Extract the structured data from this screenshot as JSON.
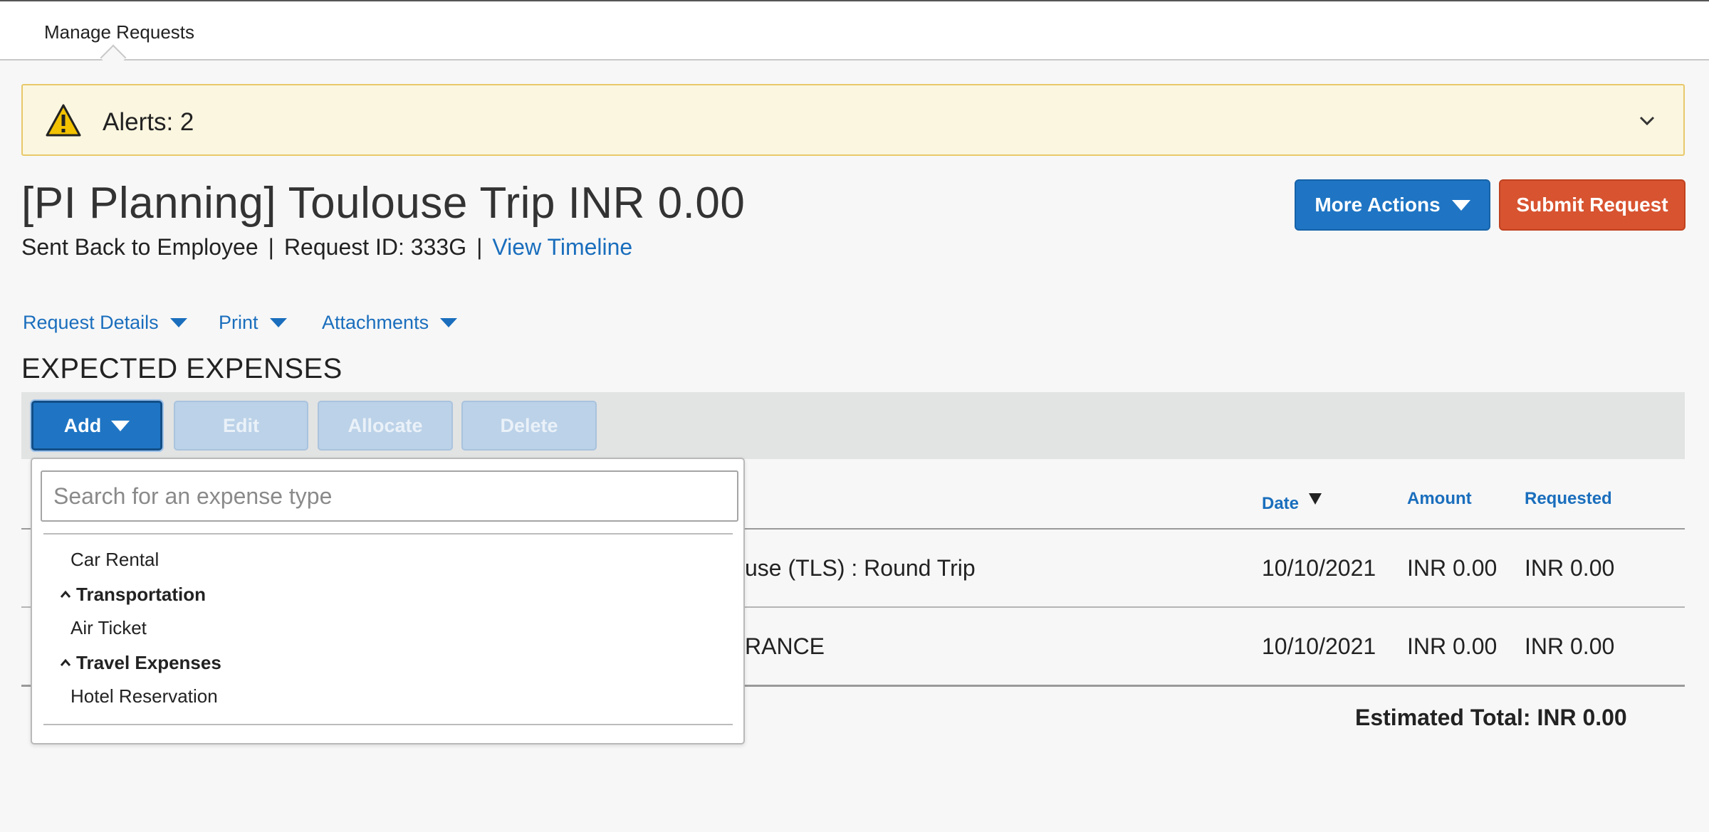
{
  "topbar": {
    "tab_label": "Manage Requests"
  },
  "alert": {
    "text": "Alerts: 2",
    "color": "#fbf6e0"
  },
  "request": {
    "title": "[PI Planning] Toulouse Trip INR 0.00",
    "status": "Sent Back to Employee",
    "separator": "|",
    "request_id": "Request ID: 333G",
    "timeline_link": "View Timeline"
  },
  "actions": {
    "more_actions": "More Actions",
    "submit": "Submit Request"
  },
  "subnav": {
    "request_details": "Request Details",
    "print": "Print",
    "attachments": "Attachments"
  },
  "expenses": {
    "section_title": "EXPECTED EXPENSES",
    "toolbar": {
      "add": "Add",
      "edit": "Edit",
      "allocate": "Allocate",
      "delete": "Delete"
    },
    "columns": {
      "date": "Date",
      "amount": "Amount",
      "requested": "Requested"
    },
    "rows": [
      {
        "description": "use (TLS) : Round Trip",
        "date": "10/10/2021",
        "amount": "INR 0.00",
        "requested": "INR 0.00"
      },
      {
        "description": "RANCE",
        "date": "10/10/2021",
        "amount": "INR 0.00",
        "requested": "INR 0.00"
      }
    ],
    "total": "Estimated Total: INR 0.00"
  },
  "dropdown": {
    "search_placeholder": "Search for an expense type",
    "search_value": "",
    "items": {
      "car_rental": "Car Rental",
      "group_transportation": "Transportation",
      "air_ticket": "Air Ticket",
      "group_travel": "Travel Expenses",
      "hotel_reservation": "Hotel Reservation"
    }
  },
  "colors": {
    "primary": "#1f75c4",
    "submit": "#d85330",
    "link": "#1a6ebd"
  }
}
